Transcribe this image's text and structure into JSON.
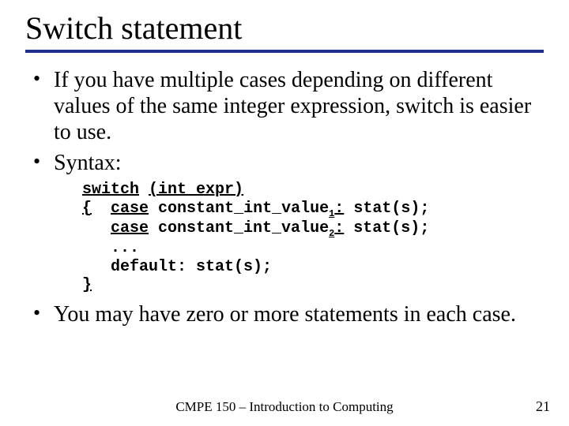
{
  "title": "Switch statement",
  "bullets": {
    "b1": "If you have multiple cases depending on different values of the same integer expression, switch is easier to use.",
    "b2": "Syntax:",
    "b3": "You may have zero or more statements in each case."
  },
  "code": {
    "l1a": "switch",
    "l1b": " ",
    "l1c": "(int_expr)",
    "l2a": "{",
    "l2b": "  ",
    "l2c": "case",
    "l2d": " constant_int_value",
    "l2e": "1",
    "l2f": ":",
    "l2g": " stat(s);",
    "l3b": "   ",
    "l3c": "case",
    "l3d": " constant_int_value",
    "l3e": "2",
    "l3f": ":",
    "l3g": " stat(s);",
    "l4": "   ...",
    "l5": "   default: stat(s);",
    "l6": "}"
  },
  "footer": {
    "center": "CMPE 150 – Introduction to Computing",
    "right": "21"
  }
}
